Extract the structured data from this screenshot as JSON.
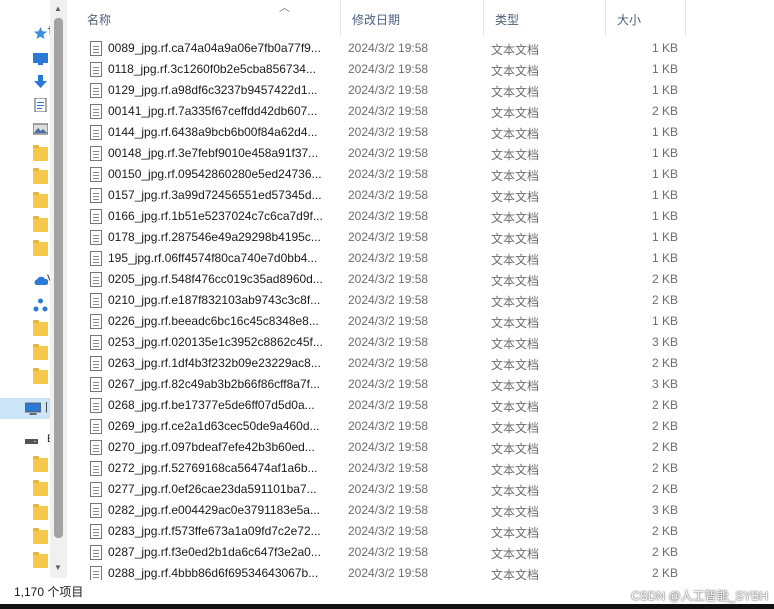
{
  "columns": {
    "name": "名称",
    "modified": "修改日期",
    "type": "类型",
    "size": "大小"
  },
  "files": [
    {
      "name": "0089_jpg.rf.ca74a04a9a06e7fb0a77f9...",
      "modified": "2024/3/2 19:58",
      "type": "文本文档",
      "size": "1 KB"
    },
    {
      "name": "0118_jpg.rf.3c1260f0b2e5cba856734...",
      "modified": "2024/3/2 19:58",
      "type": "文本文档",
      "size": "1 KB"
    },
    {
      "name": "0129_jpg.rf.a98df6c3237b9457422d1...",
      "modified": "2024/3/2 19:58",
      "type": "文本文档",
      "size": "1 KB"
    },
    {
      "name": "00141_jpg.rf.7a335f67ceffdd42db607...",
      "modified": "2024/3/2 19:58",
      "type": "文本文档",
      "size": "2 KB"
    },
    {
      "name": "0144_jpg.rf.6438a9bcb6b00f84a62d4...",
      "modified": "2024/3/2 19:58",
      "type": "文本文档",
      "size": "1 KB"
    },
    {
      "name": "00148_jpg.rf.3e7febf9010e458a91f37...",
      "modified": "2024/3/2 19:58",
      "type": "文本文档",
      "size": "1 KB"
    },
    {
      "name": "00150_jpg.rf.09542860280e5ed24736...",
      "modified": "2024/3/2 19:58",
      "type": "文本文档",
      "size": "1 KB"
    },
    {
      "name": "0157_jpg.rf.3a99d72456551ed57345d...",
      "modified": "2024/3/2 19:58",
      "type": "文本文档",
      "size": "1 KB"
    },
    {
      "name": "0166_jpg.rf.1b51e5237024c7c6ca7d9f...",
      "modified": "2024/3/2 19:58",
      "type": "文本文档",
      "size": "1 KB"
    },
    {
      "name": "0178_jpg.rf.287546e49a29298b4195c...",
      "modified": "2024/3/2 19:58",
      "type": "文本文档",
      "size": "1 KB"
    },
    {
      "name": "195_jpg.rf.06ff4574f80ca740e7d0bb4...",
      "modified": "2024/3/2 19:58",
      "type": "文本文档",
      "size": "1 KB"
    },
    {
      "name": "0205_jpg.rf.548f476cc019c35ad8960d...",
      "modified": "2024/3/2 19:58",
      "type": "文本文档",
      "size": "2 KB"
    },
    {
      "name": "0210_jpg.rf.e187f832103ab9743c3c8f...",
      "modified": "2024/3/2 19:58",
      "type": "文本文档",
      "size": "2 KB"
    },
    {
      "name": "0226_jpg.rf.beeadc6bc16c45c8348e8...",
      "modified": "2024/3/2 19:58",
      "type": "文本文档",
      "size": "1 KB"
    },
    {
      "name": "0253_jpg.rf.020135e1c3952c8862c45f...",
      "modified": "2024/3/2 19:58",
      "type": "文本文档",
      "size": "3 KB"
    },
    {
      "name": "0263_jpg.rf.1df4b3f232b09e23229ac8...",
      "modified": "2024/3/2 19:58",
      "type": "文本文档",
      "size": "2 KB"
    },
    {
      "name": "0267_jpg.rf.82c49ab3b2b66f86cff8a7f...",
      "modified": "2024/3/2 19:58",
      "type": "文本文档",
      "size": "3 KB"
    },
    {
      "name": "0268_jpg.rf.be17377e5de6ff07d5d0a...",
      "modified": "2024/3/2 19:58",
      "type": "文本文档",
      "size": "2 KB"
    },
    {
      "name": "0269_jpg.rf.ce2a1d63cec50de9a460d...",
      "modified": "2024/3/2 19:58",
      "type": "文本文档",
      "size": "2 KB"
    },
    {
      "name": "0270_jpg.rf.097bdeaf7efe42b3b60ed...",
      "modified": "2024/3/2 19:58",
      "type": "文本文档",
      "size": "2 KB"
    },
    {
      "name": "0272_jpg.rf.52769168ca56474af1a6b...",
      "modified": "2024/3/2 19:58",
      "type": "文本文档",
      "size": "2 KB"
    },
    {
      "name": "0277_jpg.rf.0ef26cae23da591101ba7...",
      "modified": "2024/3/2 19:58",
      "type": "文本文档",
      "size": "2 KB"
    },
    {
      "name": "0282_jpg.rf.e004429ac0e3791183e5a...",
      "modified": "2024/3/2 19:58",
      "type": "文本文档",
      "size": "3 KB"
    },
    {
      "name": "0283_jpg.rf.f573ffe673a1a09fd7c2e72...",
      "modified": "2024/3/2 19:58",
      "type": "文本文档",
      "size": "2 KB"
    },
    {
      "name": "0287_jpg.rf.f3e0ed2b1da6c647f3e2a0...",
      "modified": "2024/3/2 19:58",
      "type": "文本文档",
      "size": "2 KB"
    },
    {
      "name": "0288_jpg.rf.4bbb86d6f69534643067b...",
      "modified": "2024/3/2 19:58",
      "type": "文本文档",
      "size": "2 KB"
    }
  ],
  "status": {
    "item_count": "1,170 个项目"
  },
  "watermark": "CSDN @人工智能_SYBH",
  "nav": {
    "truncated_labels": [
      "V",
      "E"
    ],
    "icons": [
      "pin-icon",
      "desktop-icon",
      "downloads-icon",
      "documents-icon",
      "pictures-icon",
      "folder-icon",
      "onedrive-icon",
      "network-share-icon",
      "this-pc-icon",
      "drive-icon"
    ]
  },
  "colors": {
    "header_text": "#4c607a",
    "folder": "#f5c84c",
    "selected": "#cce4f7",
    "accent_blue": "#2a7ad5"
  }
}
